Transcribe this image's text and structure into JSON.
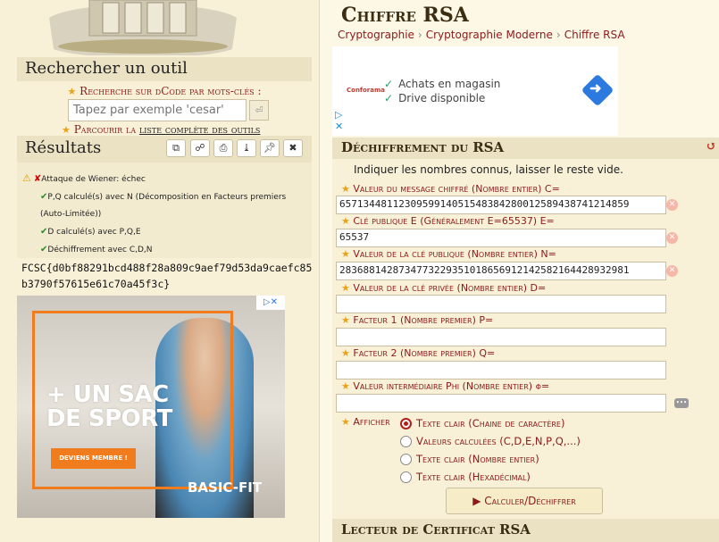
{
  "sidebar": {
    "search_title": "Rechercher un outil",
    "keyword_label": "Recherche sur dCode par mots-clés :",
    "search_placeholder": "Tapez par exemple 'cesar'",
    "browse_prefix": "Parcourir la ",
    "browse_link": "liste complète des outils",
    "results_title": "Résultats",
    "results": [
      {
        "status": "fail",
        "text": "Attaque de Wiener: échec"
      },
      {
        "status": "ok",
        "text": "P,Q calculé(s) avec N (Décomposition en Facteurs premiers"
      },
      {
        "status": "none",
        "text": "(Auto-Limitée))"
      },
      {
        "status": "ok",
        "text": "D calculé(s) avec P,Q,E"
      },
      {
        "status": "ok",
        "text": "Déchiffrement avec C,D,N"
      }
    ],
    "flag": "FCSC{d0bf88291bcd488f28a809c9aef79d53da9caefc85b3790f57615e61c70a45f3c}",
    "ad": {
      "line1": "+ UN SAC",
      "line2": "DE SPORT",
      "cta": "DEVIENS MEMBRE !",
      "brand": "BASIC-FIT"
    }
  },
  "main": {
    "title": "Chiffre RSA",
    "breadcrumb": [
      "Cryptographie",
      "Cryptographie Moderne",
      "Chiffre RSA"
    ],
    "ad_top": {
      "brand": "Conforama",
      "line1": "Achats en magasin",
      "line2": "Drive disponible"
    },
    "decode": {
      "header": "Déchiffrement du RSA",
      "intro": "Indiquer les nombres connus, laisser le reste vide.",
      "fields": [
        {
          "label": "Valeur du message chiffré (Nombre entier) C=",
          "value": "6571344811230959914051548384280012589438741214859"
        },
        {
          "label": "Clé publique E (Généralement E=65537) E=",
          "value": "65537"
        },
        {
          "label": "Valeur de la clé publique (Nombre entier) N=",
          "value": "2836881428734773229351018656912142582164428932981"
        },
        {
          "label": "Valeur de la clé privée (Nombre entier) D=",
          "value": ""
        },
        {
          "label": "Facteur 1 (Nombre premier) P=",
          "value": ""
        },
        {
          "label": "Facteur 2 (Nombre premier) Q=",
          "value": ""
        },
        {
          "label": "Valeur intermédiaire Phi (Nombre entier) φ=",
          "value": ""
        }
      ],
      "show_label": "Afficher",
      "options": [
        {
          "label": "Texte clair (Chaine de caractère)",
          "selected": true
        },
        {
          "label": "Valeurs calculées (C,D,E,N,P,Q,...)",
          "selected": false
        },
        {
          "label": "Texte clair (Nombre entier)",
          "selected": false
        },
        {
          "label": "Texte clair (Hexadécimal)",
          "selected": false
        }
      ],
      "button": "▶ Calculer/Déchiffrer"
    },
    "cert_header": "Lecteur de Certificat RSA"
  },
  "colors": {
    "accent": "#8b1a1a",
    "panel_header": "#ebe2c4",
    "ad_orange": "#f07c1d"
  }
}
